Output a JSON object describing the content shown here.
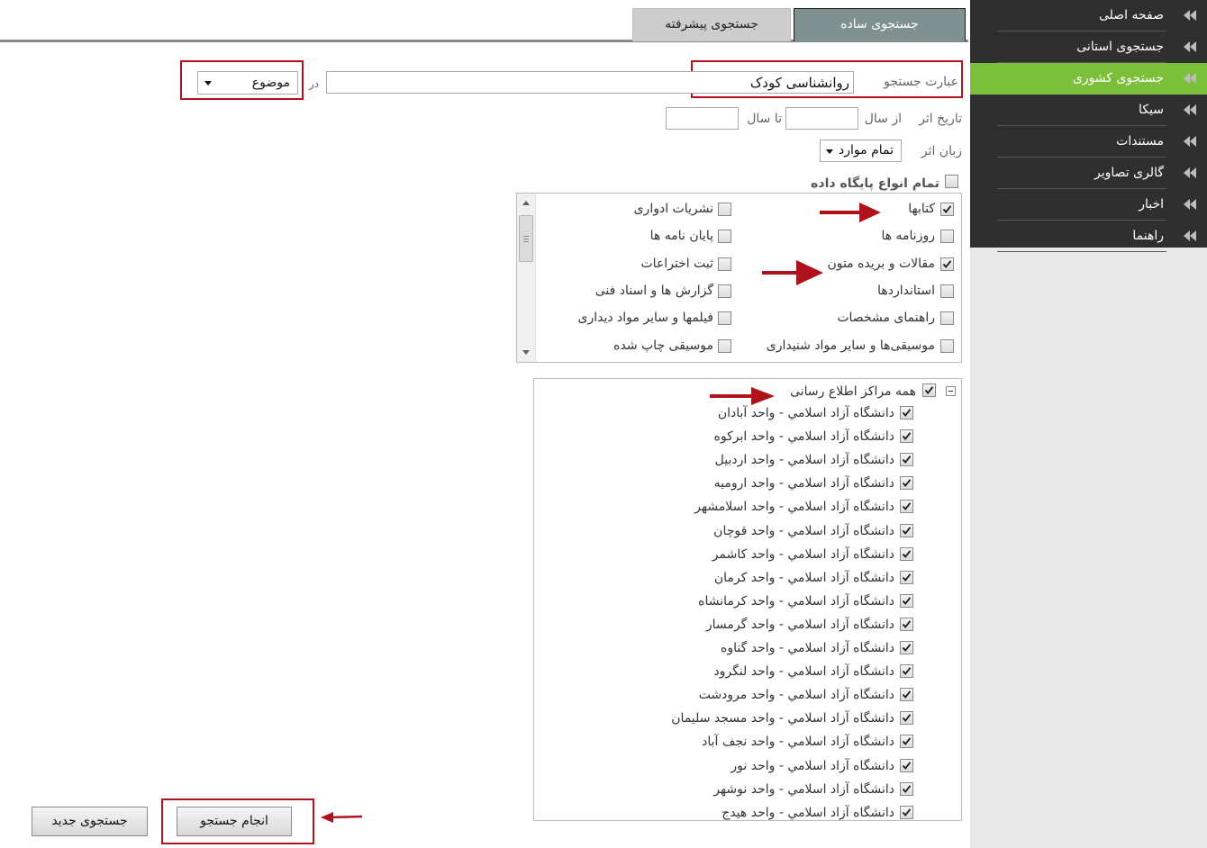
{
  "sidebar": {
    "items": [
      {
        "label": "صفحه اصلی",
        "active": false
      },
      {
        "label": "جستجوی استانی",
        "active": false
      },
      {
        "label": "جستجوی کشوری",
        "active": true
      },
      {
        "label": "سیکا",
        "active": false
      },
      {
        "label": "مستندات",
        "active": false
      },
      {
        "label": "گالری تصاویر",
        "active": false
      },
      {
        "label": "اخبار",
        "active": false
      },
      {
        "label": "راهنما",
        "active": false
      }
    ],
    "arrow_icon": "double-chevron-left-icon",
    "active_color": "#7cbf3a",
    "bg_color": "#2f2f2f"
  },
  "tabs": {
    "simple": "جستجوی ساده",
    "advanced": "جستجوی پیشرفته"
  },
  "search": {
    "phrase_label": "عبارت جستجو",
    "phrase_value": "روانشناسی کودک",
    "in_label": "در",
    "field_select": "موضوع"
  },
  "date": {
    "label": "تاریخ اثر",
    "from_label": "از سال",
    "to_label": "تا سال",
    "from_value": "",
    "to_value": ""
  },
  "language": {
    "label": "زبان اثر",
    "selected": "تمام موارد"
  },
  "db_types": {
    "all_label": "تمام انواع پایگاه داده",
    "all_checked": false,
    "right_column": [
      {
        "label": "کتابها",
        "checked": true
      },
      {
        "label": "روزنامه ها",
        "checked": false
      },
      {
        "label": "مقالات و بریده متون",
        "checked": true
      },
      {
        "label": "استانداردها",
        "checked": false
      },
      {
        "label": "راهنمای مشخصات",
        "checked": false
      },
      {
        "label": "موسیقی‌ها و سایر مواد شنیداری",
        "checked": false
      }
    ],
    "left_column": [
      {
        "label": "نشریات ادواری",
        "checked": false
      },
      {
        "label": "پایان نامه ها",
        "checked": false
      },
      {
        "label": "ثبت اختراعات",
        "checked": false
      },
      {
        "label": "گزارش ها و اسناد فنی",
        "checked": false
      },
      {
        "label": "فیلمها و سایر مواد دیداری",
        "checked": false
      },
      {
        "label": "موسیقی چاپ شده",
        "checked": false
      }
    ]
  },
  "centers": {
    "all_label": "همه مراکز اطلاع رسانی",
    "all_checked": true,
    "items": [
      "دانشگاه آزاد اسلامي - واحد آبادان",
      "دانشگاه آزاد اسلامي - واحد ابرکوه",
      "دانشگاه آزاد اسلامي - واحد اردبيل",
      "دانشگاه آزاد اسلامي - واحد اروميه",
      "دانشگاه آزاد اسلامي - واحد اسلامشهر",
      "دانشگاه آزاد اسلامي - واحد قوچان",
      "دانشگاه آزاد اسلامي - واحد کاشمر",
      "دانشگاه آزاد اسلامي - واحد کرمان",
      "دانشگاه آزاد اسلامي - واحد کرمانشاه",
      "دانشگاه آزاد اسلامي - واحد گرمسار",
      "دانشگاه آزاد اسلامي - واحد گناوه",
      "دانشگاه آزاد اسلامي - واحد لنگرود",
      "دانشگاه آزاد اسلامي - واحد مرودشت",
      "دانشگاه آزاد اسلامي - واحد مسجد سليمان",
      "دانشگاه آزاد اسلامي - واحد نجف آباد",
      "دانشگاه آزاد اسلامي - واحد نور",
      "دانشگاه آزاد اسلامي - واحد نوشهر",
      "دانشگاه آزاد اسلامي - واحد هيدج"
    ]
  },
  "buttons": {
    "search": "انجام جستجو",
    "new_search": "جستجوی جدید"
  },
  "annotation_color": "#b0121b"
}
